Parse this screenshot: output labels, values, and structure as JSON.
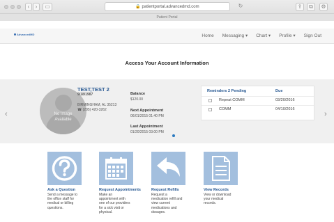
{
  "browser": {
    "url": "patientportal.advancedmd.com",
    "tab_title": "Patient Portal"
  },
  "logo": {
    "text": "AdvancedMD"
  },
  "nav": {
    "home": "Home",
    "messaging": "Messaging ▾",
    "chart": "Chart ▾",
    "profile": "Profile ▾",
    "signout": "Sign Out"
  },
  "page_title": "Access Your Account Information",
  "patient": {
    "avatar_text_1": "No Image",
    "avatar_text_2": "Available",
    "name": "TEST,TEST 2",
    "dob": "9/18/1987",
    "address": "BIRMINGHAM, AL 35213",
    "phone": "(205) 420-3262",
    "balance_label": "Balance",
    "balance": "$120.00",
    "next_label": "Next Appointment",
    "next": "06/01/2015 01:40 PM",
    "last_label": "Last Appointment",
    "last": "01/20/2015 03:00 PM"
  },
  "reminders": {
    "header": "Reminders 2 Pending",
    "due_header": "Due",
    "items": [
      {
        "name": "Repeat COMM",
        "due": "03/20/2016"
      },
      {
        "name": "COMM",
        "due": "04/10/2016"
      }
    ]
  },
  "carousel": {
    "prev": "‹",
    "next": "›"
  },
  "tiles": [
    {
      "label": "Ask a Question",
      "desc": [
        "Send a message to",
        "the office staff for",
        "medical or billing",
        "questions."
      ],
      "icon": "question-icon"
    },
    {
      "label": "Request Appointments",
      "desc": [
        "Make an",
        "appointment with",
        "one of our providers",
        "for a sick visit or",
        "physical."
      ],
      "icon": "calendar-icon"
    },
    {
      "label": "Request Refills",
      "desc": [
        "Request a",
        "medication refill and",
        "view current",
        "medications and",
        "dosages."
      ],
      "icon": "reply-arrow-icon"
    },
    {
      "label": "View Records",
      "desc": [
        "View or download",
        "your medical",
        "records."
      ],
      "icon": "document-icon"
    }
  ]
}
